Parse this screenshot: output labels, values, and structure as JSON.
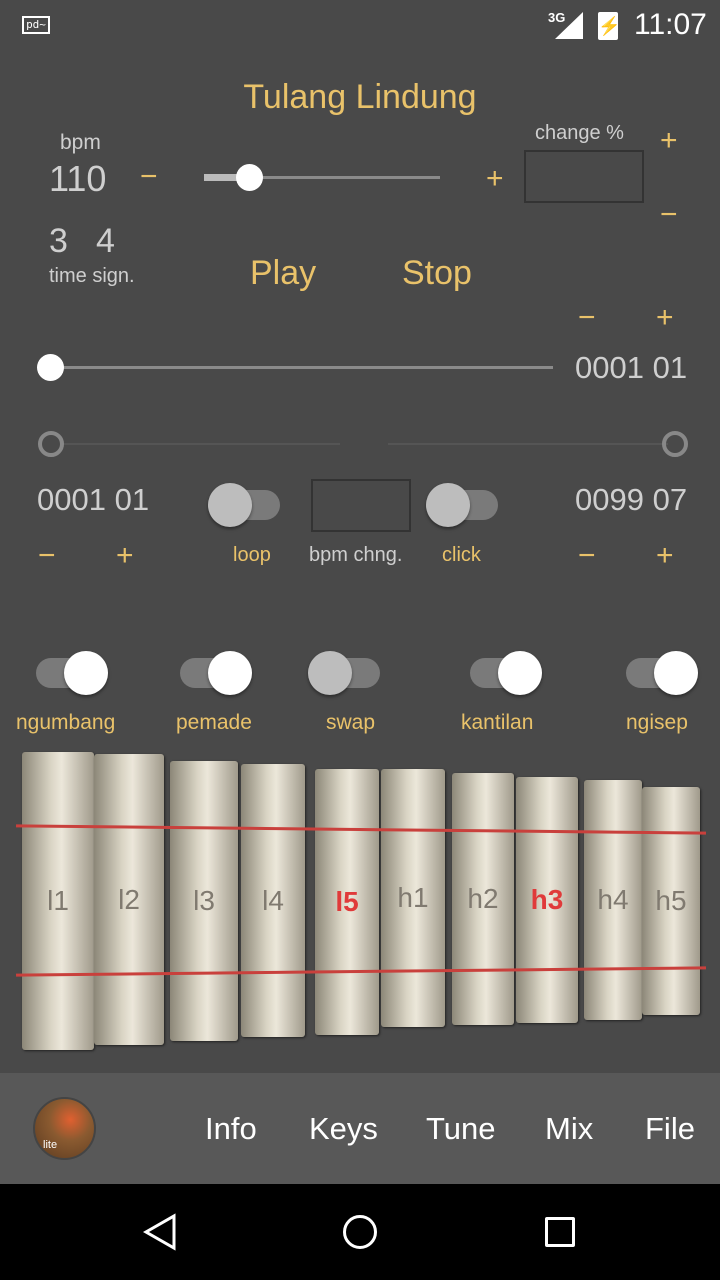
{
  "status": {
    "app_icon": "pd-icon",
    "network": "3G",
    "time": "11:07",
    "icons": [
      "signal-icon",
      "battery-charging-icon"
    ]
  },
  "title": "Tulang Lindung",
  "bpm": {
    "label": "bpm",
    "value": "110",
    "minus": "−",
    "plus": "+",
    "slider_fraction": 0.19
  },
  "change": {
    "label": "change %",
    "value": "",
    "plus": "+",
    "minus": "−"
  },
  "time_sig": {
    "numerator": "3",
    "denominator": "4",
    "label": "time sign."
  },
  "transport": {
    "play": "Play",
    "stop": "Stop"
  },
  "position": {
    "minus": "−",
    "plus": "+",
    "value": "0001 01",
    "slider_fraction": 0.0
  },
  "range": {
    "start": "0001 01",
    "end": "0099 07",
    "start_minus": "−",
    "start_plus": "+",
    "end_minus": "−",
    "end_plus": "+"
  },
  "toggles_mid": {
    "loop": {
      "label": "loop",
      "on": false
    },
    "bpm_change": {
      "label": "bpm chng.",
      "value": ""
    },
    "click": {
      "label": "click",
      "on": false
    }
  },
  "instruments": [
    {
      "label": "ngumbang",
      "on": true
    },
    {
      "label": "pemade",
      "on": true
    },
    {
      "label": "swap",
      "on": false
    },
    {
      "label": "kantilan",
      "on": true
    },
    {
      "label": "ngisep",
      "on": true
    }
  ],
  "keys": [
    {
      "label": "l1",
      "highlight": false
    },
    {
      "label": "l2",
      "highlight": false
    },
    {
      "label": "l3",
      "highlight": false
    },
    {
      "label": "l4",
      "highlight": false
    },
    {
      "label": "l5",
      "highlight": true
    },
    {
      "label": "h1",
      "highlight": false
    },
    {
      "label": "h2",
      "highlight": false
    },
    {
      "label": "h3",
      "highlight": true
    },
    {
      "label": "h4",
      "highlight": false
    },
    {
      "label": "h5",
      "highlight": false
    }
  ],
  "bottom_bar": {
    "logo_text": "lite",
    "items": [
      "Info",
      "Keys",
      "Tune",
      "Mix",
      "File"
    ]
  },
  "colors": {
    "accent": "#e9c26a",
    "highlight": "#e03a3a",
    "background": "#494949"
  }
}
